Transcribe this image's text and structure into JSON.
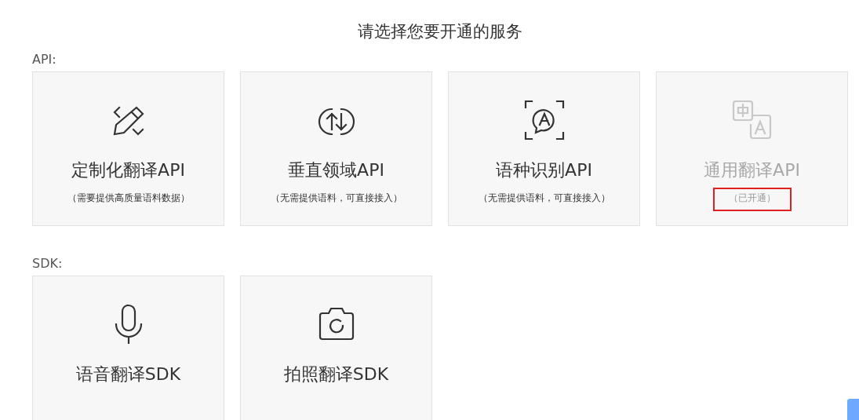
{
  "heading": "请选择您要开通的服务",
  "sections": [
    {
      "label": "API:",
      "cards": [
        {
          "kind": "pencil",
          "title": "定制化翻译API",
          "note": "（需要提供高质量语料数据）",
          "disabled": false
        },
        {
          "kind": "sync",
          "title": "垂直领域API",
          "note": "（无需提供语料，可直接接入）",
          "disabled": false
        },
        {
          "kind": "scan",
          "title": "语种识别API",
          "note": "（无需提供语料，可直接接入）",
          "disabled": false
        },
        {
          "kind": "translate",
          "title": "通用翻译API",
          "note": "（已开通）",
          "disabled": true,
          "highlighted": true
        }
      ]
    },
    {
      "label": "SDK:",
      "cards": [
        {
          "kind": "mic",
          "title": "语音翻译SDK",
          "disabled": false
        },
        {
          "kind": "camera",
          "title": "拍照翻译SDK",
          "disabled": false
        }
      ]
    }
  ]
}
